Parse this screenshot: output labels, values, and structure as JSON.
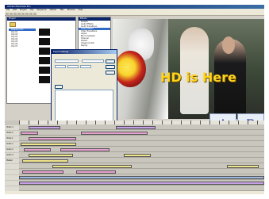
{
  "app": {
    "title": "Adobe Premiere Pro"
  },
  "menu": [
    "File",
    "Edit",
    "Project",
    "Clip",
    "Sequence",
    "Marker",
    "Title",
    "Window",
    "Help"
  ],
  "project": {
    "title": "Project",
    "tree": [
      "Sequence 01",
      "Clip 01",
      "Clip 02",
      "Clip 03",
      "Clip 04",
      "Clip 05",
      "Clip 06",
      "Clip 07"
    ]
  },
  "effects": {
    "title": "Effects",
    "tree": [
      "Presets",
      "Audio Effects",
      "Audio Transitions",
      "Video Effects",
      "Video Transitions",
      "Adjust",
      "Blur & Sharpen",
      "Channel",
      "Distort",
      "Image Control",
      "Keying"
    ]
  },
  "export_dialog": {
    "title": "Export Settings",
    "rows": [
      "",
      "",
      "",
      "",
      "",
      "",
      "",
      ""
    ]
  },
  "monitor": {
    "headline": "HD is Here"
  },
  "small_dialog": {
    "title": ""
  },
  "letters": {
    "a": "A",
    "b": "B"
  },
  "timeline": {
    "tracks": [
      "Video 3",
      "Video 2",
      "Video 1",
      "Audio 1",
      "Audio 2",
      "Audio 3",
      "Master",
      "",
      "",
      "",
      "",
      ""
    ]
  },
  "colors": {
    "clip_yellow": "#f0e68c",
    "clip_pink": "#e8a0d0",
    "clip_purple": "#c8a0e8",
    "clip_blue": "#9fb8e0"
  }
}
